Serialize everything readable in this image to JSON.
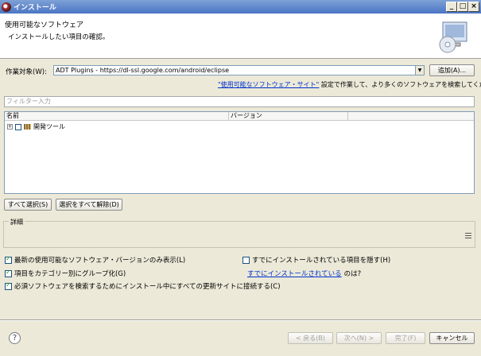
{
  "window": {
    "title": "インストール",
    "minimize": "_",
    "maximize": "□",
    "close": "×"
  },
  "header": {
    "title": "使用可能なソフトウェア",
    "subtitle": "インストールしたい項目の確認。"
  },
  "worksite": {
    "label": "作業対象(W):",
    "value": "ADT Plugins - https://dl-ssl.google.com/android/eclipse",
    "add_button": "追加(A)..."
  },
  "sites_hint": {
    "link": "\"使用可能なソフトウェア・サイト\"",
    "text": " 設定で作業して、より多くのソフトウェアを検索してください。"
  },
  "filter": {
    "placeholder": "フィルター入力"
  },
  "table": {
    "columns": [
      "名前",
      "バージョン",
      ""
    ],
    "rows": [
      {
        "expander": "+",
        "name": "開発ツール",
        "version": ""
      }
    ]
  },
  "selection": {
    "select_all": "すべて選択(S)",
    "deselect_all": "選択をすべて解除(D)"
  },
  "details": {
    "legend": "詳細"
  },
  "options": {
    "latest_only": "最新の使用可能なソフトウェア・バージョンのみ表示(L)",
    "hide_installed": "すでにインストールされている項目を隠す(H)",
    "group_by_category": "項目をカテゴリー別にグループ化(G)",
    "already_installed_link": "すでにインストールされている",
    "already_installed_suffix": "のは?",
    "contact_sites": "必須ソフトウェアを検索するためにインストール中にすべての更新サイトに接続する(C)"
  },
  "footer": {
    "help": "?",
    "back": "< 戻る(B)",
    "next": "次へ(N) >",
    "finish": "完了(F)",
    "cancel": "キャンセル"
  }
}
